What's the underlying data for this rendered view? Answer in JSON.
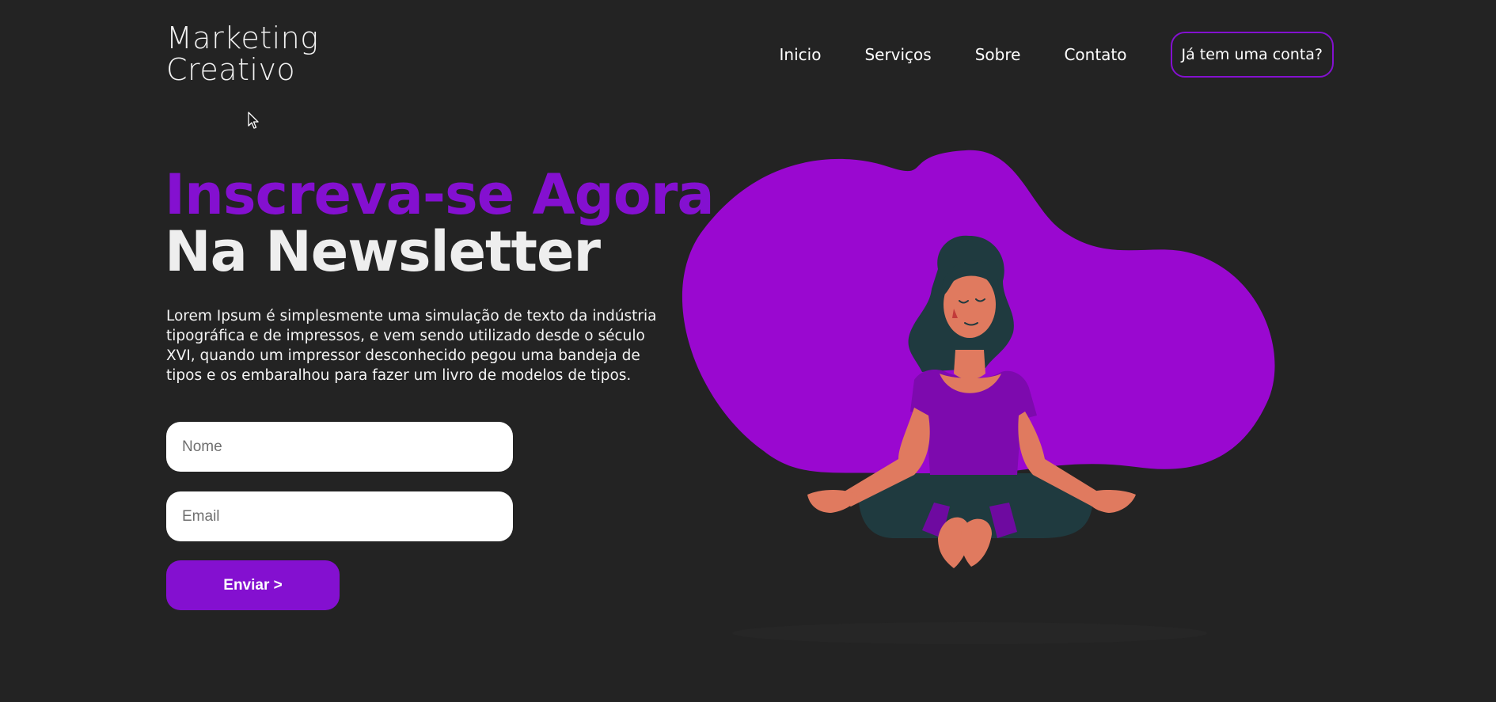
{
  "brand": {
    "line1": "Marketing",
    "line2": "Creativo"
  },
  "nav": {
    "items": [
      {
        "label": "Inicio"
      },
      {
        "label": "Serviços"
      },
      {
        "label": "Sobre"
      },
      {
        "label": "Contato"
      }
    ],
    "login_label": "Já tem uma conta?"
  },
  "hero": {
    "headline_line1": "Inscreva-se Agora",
    "headline_line2": "Na Newsletter",
    "description": "Lorem Ipsum é simplesmente uma simulação de texto da indústria tipográfica e de impressos, e vem sendo utilizado desde o século XVI, quando um impressor desconhecido pegou uma bandeja de tipos e os embaralhou para fazer um livro de modelos de tipos."
  },
  "form": {
    "name_placeholder": "Nome",
    "email_placeholder": "Email",
    "submit_label": "Enviar >"
  },
  "theme": {
    "background": "#232323",
    "accent": "#8410d0",
    "blob": "#9a08d0",
    "skin": "#e07a5f",
    "hair": "#1f3a3f"
  },
  "icons": {
    "cursor": "mouse-pointer-icon",
    "illustration": "meditating-woman-illustration"
  }
}
